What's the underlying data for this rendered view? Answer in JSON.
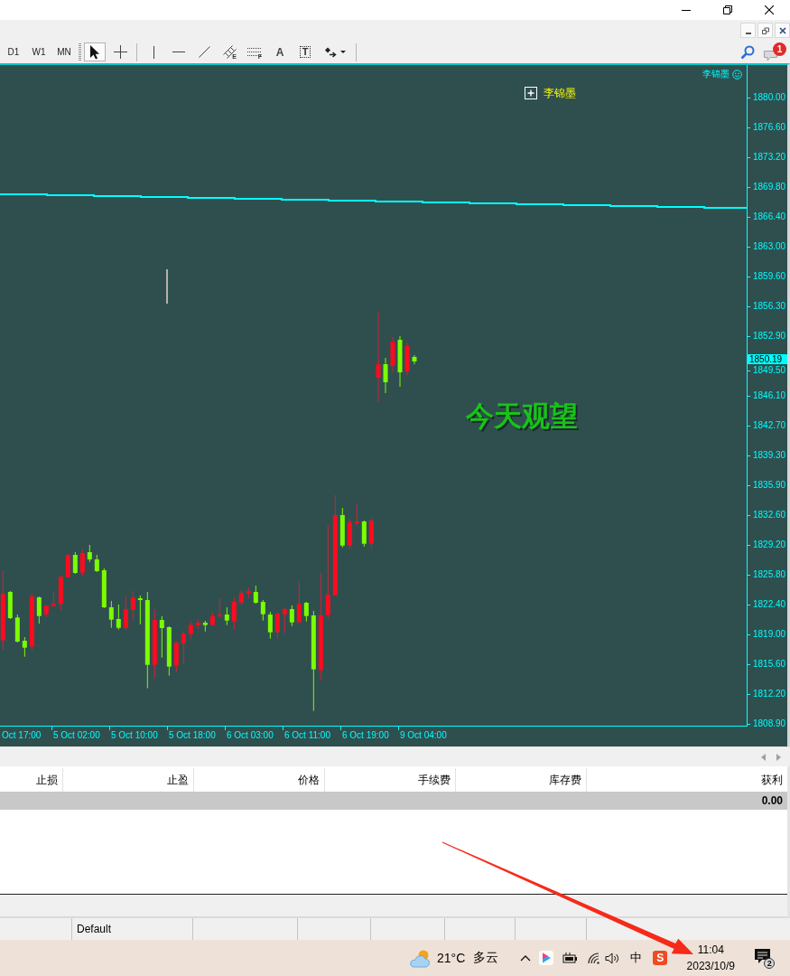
{
  "toolbar": {
    "timeframes": [
      {
        "label": "D1",
        "selected": false
      },
      {
        "label": "W1",
        "selected": false
      },
      {
        "label": "MN",
        "selected": false
      }
    ],
    "tools": [
      {
        "kind": "cursor",
        "selected": true
      },
      {
        "kind": "crosshair",
        "selected": false
      },
      {
        "kind": "vertical_line",
        "selected": false
      },
      {
        "kind": "horizontal_line",
        "selected": false
      },
      {
        "kind": "trendline",
        "selected": false
      },
      {
        "kind": "channel",
        "glyph": "E",
        "selected": false
      },
      {
        "kind": "fibonacci",
        "glyph": "F",
        "selected": false
      },
      {
        "kind": "text",
        "glyph": "A",
        "selected": false
      },
      {
        "kind": "label",
        "glyph": "T",
        "selected": false
      },
      {
        "kind": "arrows",
        "selected": false
      }
    ],
    "alerts_badge": "1"
  },
  "chart": {
    "expert_label": "李锦墨",
    "object_label": "李锦墨",
    "note": "今天观望",
    "price_ticks": [
      "1880.00",
      "1876.60",
      "1873.20",
      "1869.80",
      "1866.40",
      "1863.00",
      "1859.60",
      "1856.30",
      "1852.90",
      "1849.50",
      "1846.10",
      "1842.70",
      "1839.30",
      "1835.90",
      "1832.60",
      "1829.20",
      "1825.80",
      "1822.40",
      "1819.00",
      "1815.60",
      "1812.20",
      "1808.90"
    ],
    "current_price": "1850.19",
    "time_ticks": [
      "Oct 17:00",
      "5 Oct 02:00",
      "5 Oct 10:00",
      "5 Oct 18:00",
      "6 Oct 03:00",
      "6 Oct 11:00",
      "6 Oct 19:00",
      "9 Oct 04:00"
    ]
  },
  "terminal": {
    "columns": [
      "止损",
      "止盈",
      "价格",
      "手续费",
      "库存费",
      "获利"
    ],
    "total_profit": "0.00"
  },
  "status_bar": {
    "profile": "Default"
  },
  "taskbar": {
    "temperature": "21°C",
    "weather": "多云",
    "input_mode": "中",
    "ime_logo": "S",
    "time": "11:04",
    "date": "2023/10/9",
    "notification_count": "2"
  }
}
